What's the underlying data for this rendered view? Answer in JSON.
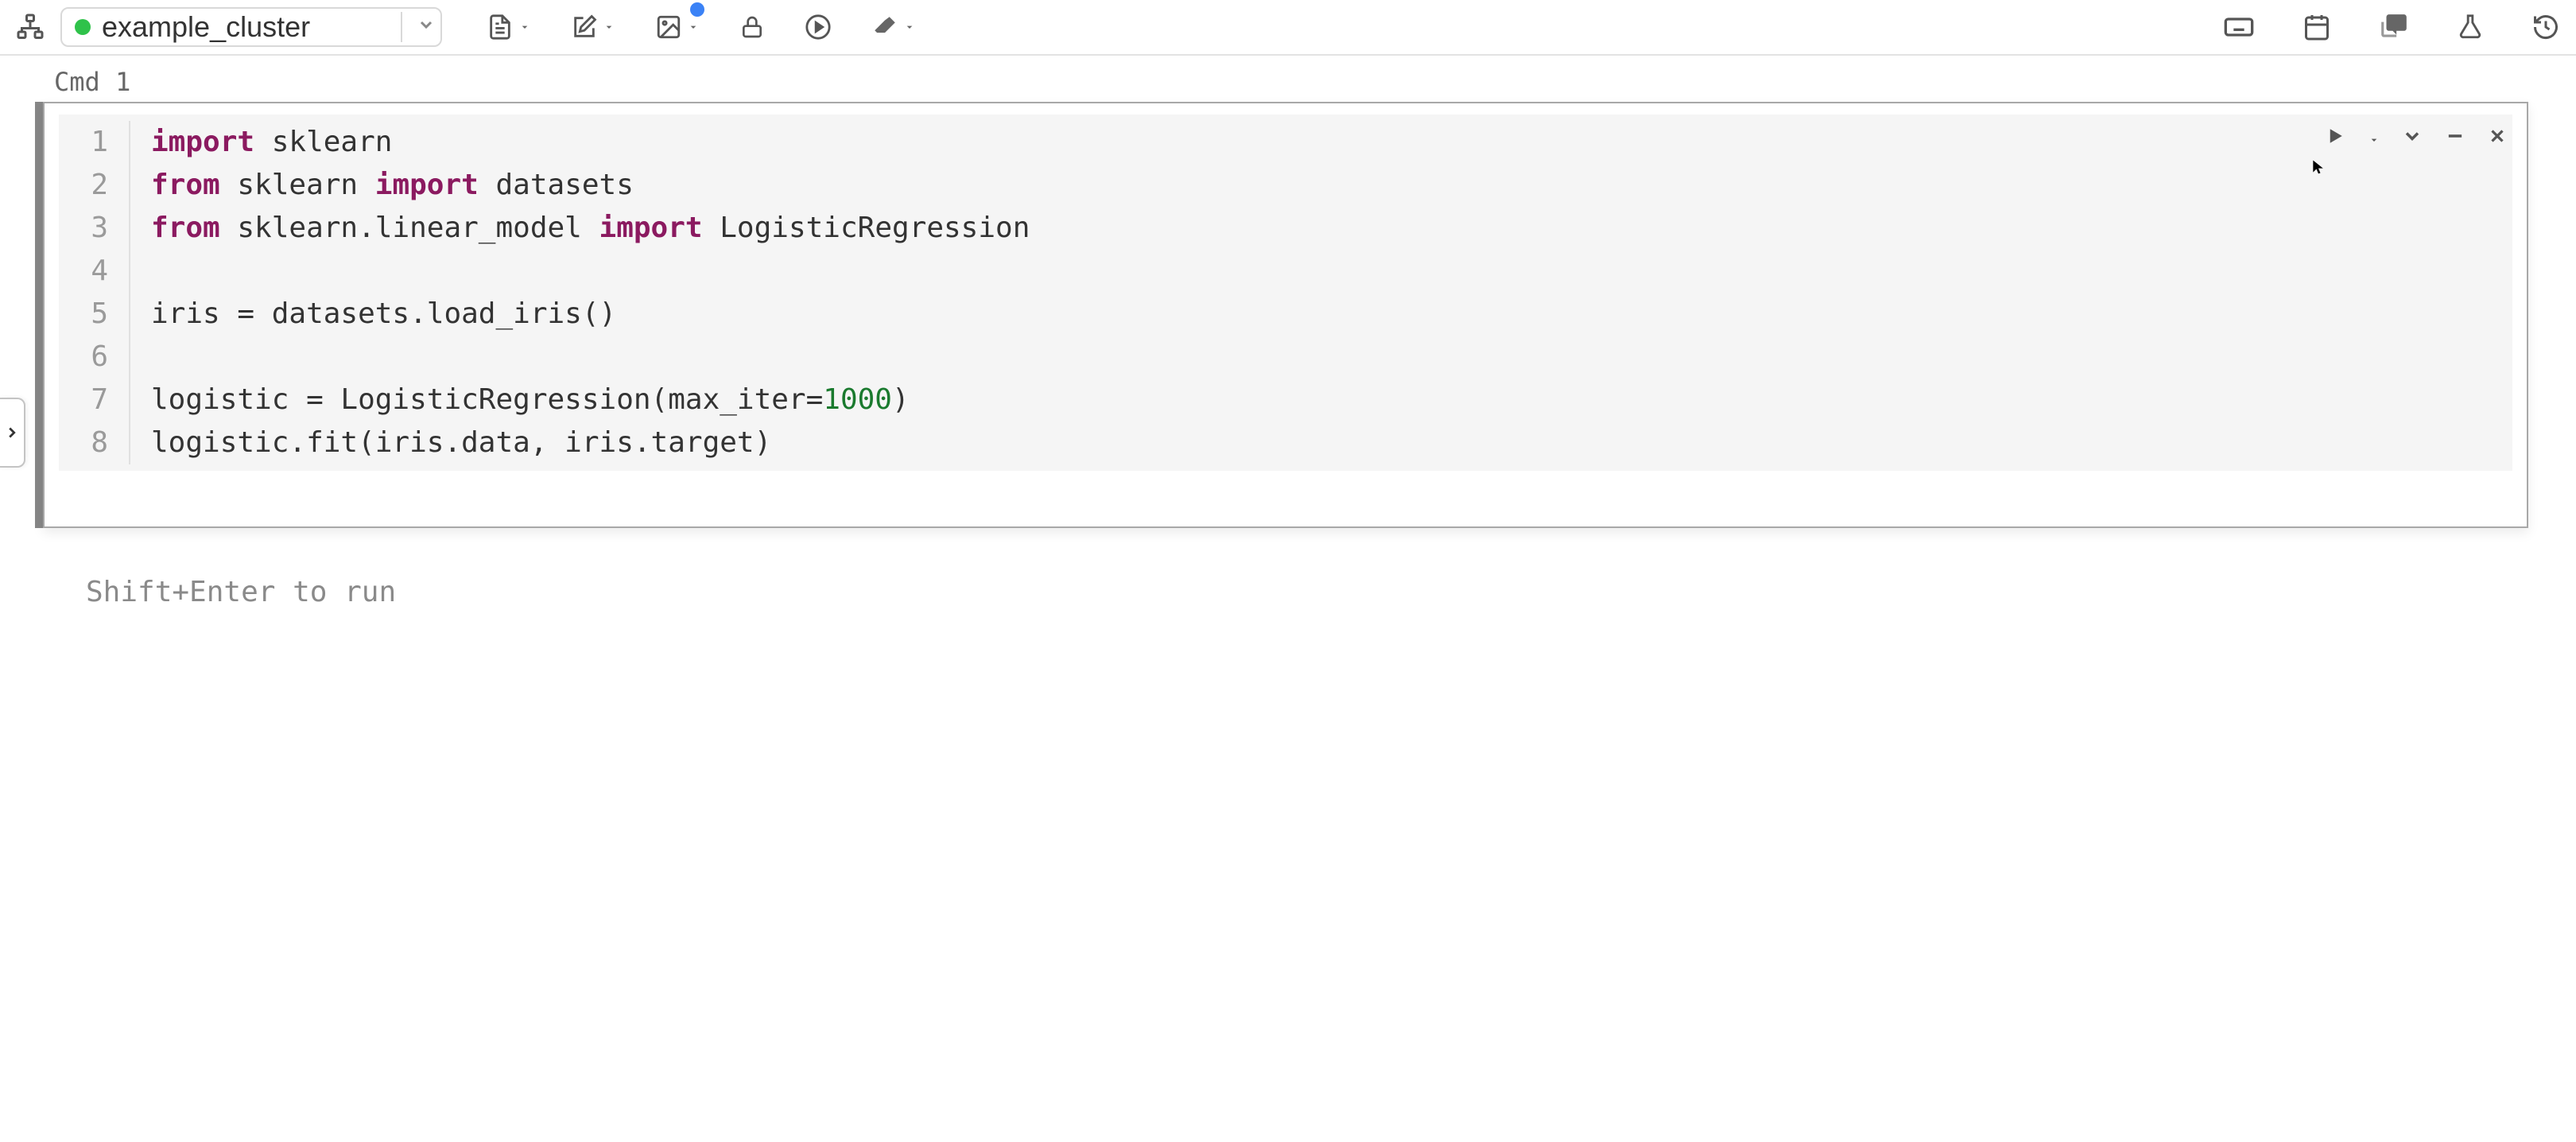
{
  "toolbar": {
    "cluster_name": "example_cluster",
    "cluster_status_color": "#2fc24a",
    "icons": {
      "tree": "tree-icon",
      "file": "file-icon",
      "edit": "edit-icon",
      "image": "image-icon",
      "lock": "lock-icon",
      "run_all": "run-all-icon",
      "clear": "clear-icon",
      "keyboard": "keyboard-shortcuts-icon",
      "schedule": "schedule-icon",
      "comments": "comments-icon",
      "experiments": "experiments-icon",
      "revision": "revision-history-icon"
    }
  },
  "cell": {
    "label": "Cmd 1",
    "lines": [
      {
        "n": "1",
        "tokens": [
          {
            "t": "import",
            "c": "kw"
          },
          {
            "t": " sklearn"
          }
        ]
      },
      {
        "n": "2",
        "tokens": [
          {
            "t": "from",
            "c": "kw"
          },
          {
            "t": " sklearn "
          },
          {
            "t": "import",
            "c": "kw"
          },
          {
            "t": " datasets"
          }
        ]
      },
      {
        "n": "3",
        "tokens": [
          {
            "t": "from",
            "c": "kw"
          },
          {
            "t": " sklearn.linear_model "
          },
          {
            "t": "import",
            "c": "kw"
          },
          {
            "t": " LogisticRegression"
          }
        ]
      },
      {
        "n": "4",
        "tokens": [
          {
            "t": ""
          }
        ]
      },
      {
        "n": "5",
        "tokens": [
          {
            "t": "iris = datasets.load_iris()"
          }
        ]
      },
      {
        "n": "6",
        "tokens": [
          {
            "t": ""
          }
        ]
      },
      {
        "n": "7",
        "tokens": [
          {
            "t": "logistic = LogisticRegression(max_iter="
          },
          {
            "t": "1000",
            "c": "num"
          },
          {
            "t": ")"
          }
        ]
      },
      {
        "n": "8",
        "tokens": [
          {
            "t": "logistic.fit(iris.data, iris.target)"
          }
        ]
      }
    ],
    "actions": {
      "run": "run-cell",
      "expand": "expand-cell",
      "minimize": "minimize-cell",
      "close": "close-cell"
    }
  },
  "hint": "Shift+Enter to run"
}
